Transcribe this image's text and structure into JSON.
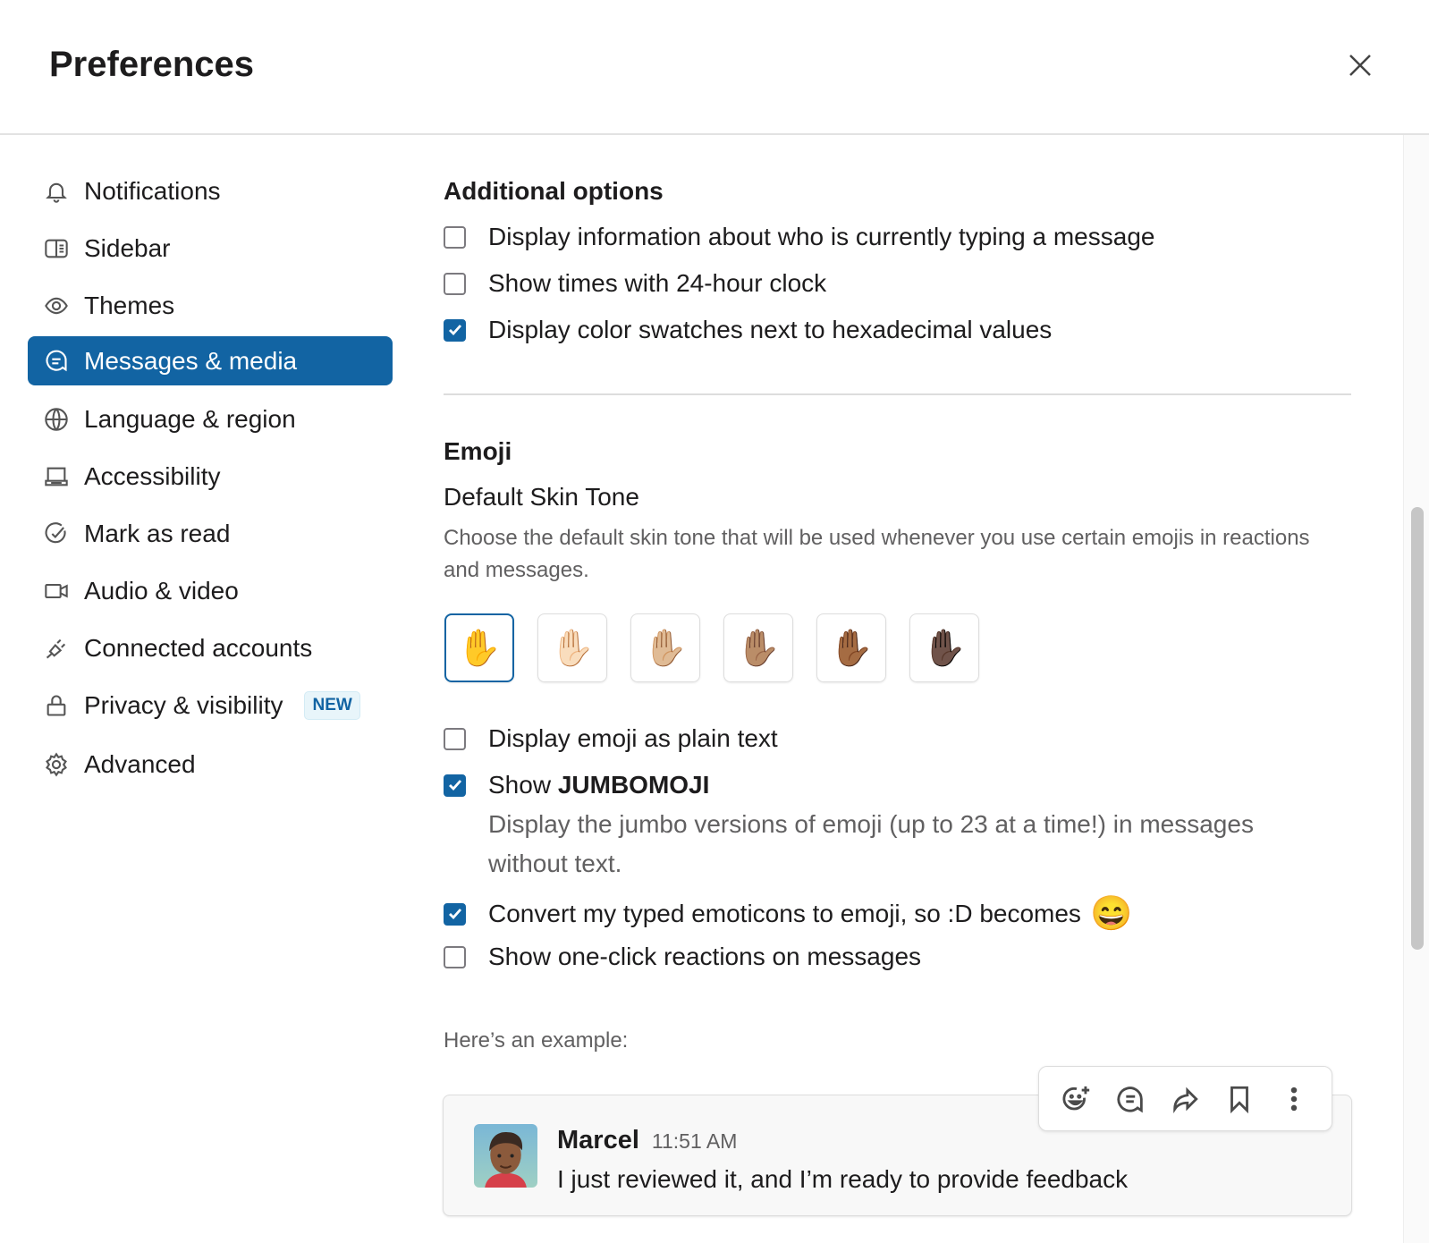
{
  "header": {
    "title": "Preferences"
  },
  "sidebar": {
    "items": [
      {
        "label": "Notifications",
        "icon": "bell-icon"
      },
      {
        "label": "Sidebar",
        "icon": "sidebar-icon"
      },
      {
        "label": "Themes",
        "icon": "eye-icon"
      },
      {
        "label": "Messages & media",
        "icon": "message-icon",
        "active": true
      },
      {
        "label": "Language & region",
        "icon": "globe-icon"
      },
      {
        "label": "Accessibility",
        "icon": "keyboard-icon"
      },
      {
        "label": "Mark as read",
        "icon": "check-circle-icon"
      },
      {
        "label": "Audio & video",
        "icon": "video-icon"
      },
      {
        "label": "Connected accounts",
        "icon": "plug-icon"
      },
      {
        "label": "Privacy & visibility",
        "icon": "lock-icon",
        "badge": "NEW"
      },
      {
        "label": "Advanced",
        "icon": "gear-icon"
      }
    ]
  },
  "additional": {
    "heading": "Additional options",
    "options": [
      {
        "label": "Display information about who is currently typing a message",
        "checked": false
      },
      {
        "label": "Show times with 24-hour clock",
        "checked": false
      },
      {
        "label": "Display color swatches next to hexadecimal values",
        "checked": true
      }
    ]
  },
  "emoji": {
    "heading": "Emoji",
    "skin_tone_title": "Default Skin Tone",
    "skin_tone_desc": "Choose the default skin tone that will be used whenever you use certain emojis in reactions and messages.",
    "tones": [
      "✋",
      "✋🏻",
      "✋🏼",
      "✋🏽",
      "✋🏾",
      "✋🏿"
    ],
    "selected_tone": 0,
    "options": [
      {
        "label": "Display emoji as plain text",
        "checked": false
      },
      {
        "label_prefix": "Show ",
        "label_bold": "JUMBOMOJI",
        "checked": true,
        "desc": "Display the jumbo versions of emoji (up to 23 at a time!) in messages without text."
      },
      {
        "label": "Convert my typed emoticons to emoji, so :D becomes",
        "emoji": "😄",
        "checked": true
      },
      {
        "label": "Show one-click reactions on messages",
        "checked": false
      }
    ]
  },
  "example": {
    "label": "Here’s an example:",
    "author": "Marcel",
    "time": "11:51 AM",
    "text": "I just reviewed it, and I’m ready to provide feedback"
  },
  "colors": {
    "accent": "#1264a3"
  }
}
